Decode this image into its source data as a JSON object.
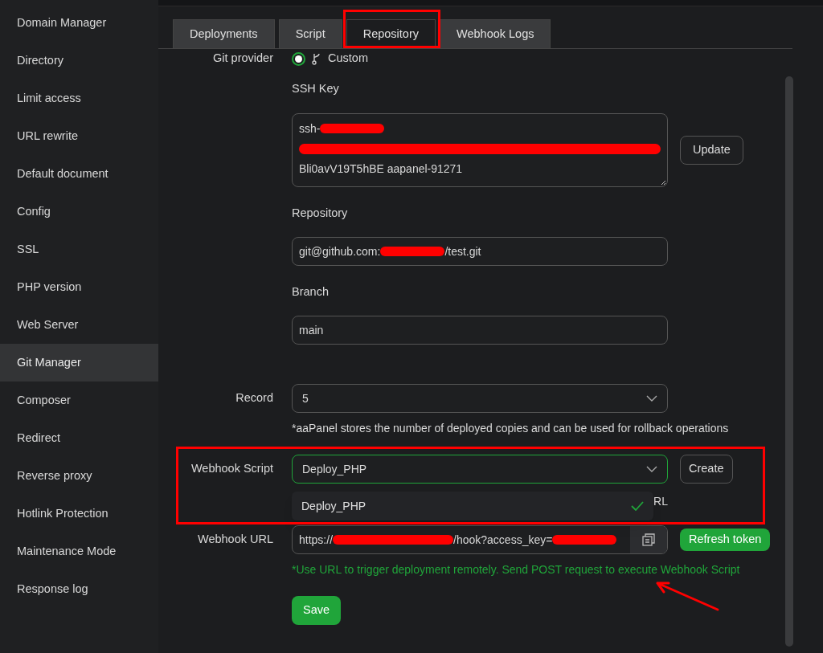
{
  "sidebar": {
    "items": [
      {
        "label": "Domain Manager",
        "selected": false
      },
      {
        "label": "Directory",
        "selected": false
      },
      {
        "label": "Limit access",
        "selected": false
      },
      {
        "label": "URL rewrite",
        "selected": false
      },
      {
        "label": "Default document",
        "selected": false
      },
      {
        "label": "Config",
        "selected": false
      },
      {
        "label": "SSL",
        "selected": false
      },
      {
        "label": "PHP version",
        "selected": false
      },
      {
        "label": "Web Server",
        "selected": false
      },
      {
        "label": "Git Manager",
        "selected": true
      },
      {
        "label": "Composer",
        "selected": false
      },
      {
        "label": "Redirect",
        "selected": false
      },
      {
        "label": "Reverse proxy",
        "selected": false
      },
      {
        "label": "Hotlink Protection",
        "selected": false
      },
      {
        "label": "Maintenance Mode",
        "selected": false
      },
      {
        "label": "Response log",
        "selected": false
      }
    ]
  },
  "tabs": [
    {
      "label": "Deployments",
      "selected": false
    },
    {
      "label": "Script",
      "selected": false
    },
    {
      "label": "Repository",
      "selected": true
    },
    {
      "label": "Webhook Logs",
      "selected": false
    }
  ],
  "form": {
    "git_provider": {
      "label": "Git provider",
      "option": "Custom",
      "selected": true
    },
    "ssh_key": {
      "label": "SSH Key",
      "lines": [
        [
          {
            "kind": "text",
            "text": "ssh-"
          },
          {
            "kind": "redacted"
          }
        ],
        [
          {
            "kind": "redacted_line"
          }
        ],
        [
          {
            "kind": "text",
            "text": "Bli0avV19T5hBE aapanel-91271"
          }
        ]
      ],
      "button": "Update"
    },
    "repository": {
      "label": "Repository",
      "value": [
        {
          "kind": "text",
          "text": "git@github.com:"
        },
        {
          "kind": "redacted"
        },
        {
          "kind": "text",
          "text": "/test.git"
        }
      ]
    },
    "branch": {
      "label": "Branch",
      "value": "main"
    },
    "record": {
      "label": "Record",
      "value": "5",
      "note": "*aaPanel stores the number of deployed copies and can be used for rollback operations"
    },
    "webhook_script": {
      "label": "Webhook Script",
      "value": "Deploy_PHP",
      "focused": true,
      "button": "Create",
      "options": [
        {
          "label": "Deploy_PHP",
          "selected": true
        }
      ],
      "covered_hint": "RL"
    },
    "webhook_url": {
      "label": "Webhook URL",
      "value": [
        {
          "kind": "text",
          "text": "https://"
        },
        {
          "kind": "redacted_long"
        },
        {
          "kind": "text",
          "text": "/hook?access_key="
        },
        {
          "kind": "redacted"
        }
      ],
      "button": "Refresh token",
      "hint": "*Use URL to trigger deployment remotely. Send POST request to execute Webhook Script"
    },
    "save": "Save"
  }
}
